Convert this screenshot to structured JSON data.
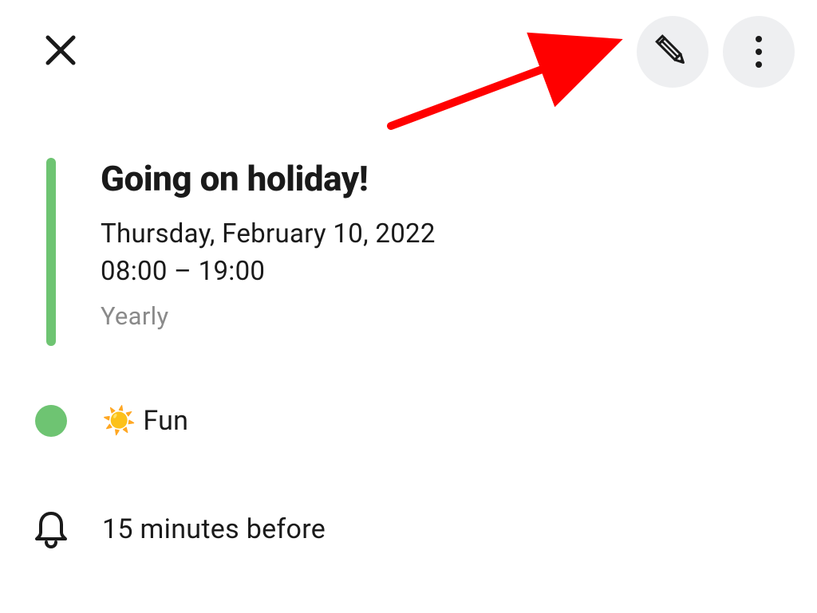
{
  "event": {
    "title": "Going on holiday!",
    "date": "Thursday, February 10, 2022",
    "time": "08:00 – 19:00",
    "recurrence": "Yearly"
  },
  "category": {
    "emoji": "☀️",
    "name": "Fun",
    "color": "#6ec472"
  },
  "reminder": {
    "label": "15 minutes before"
  },
  "accent_color": "#6ec472",
  "annotation_arrow_color": "#ff0000"
}
